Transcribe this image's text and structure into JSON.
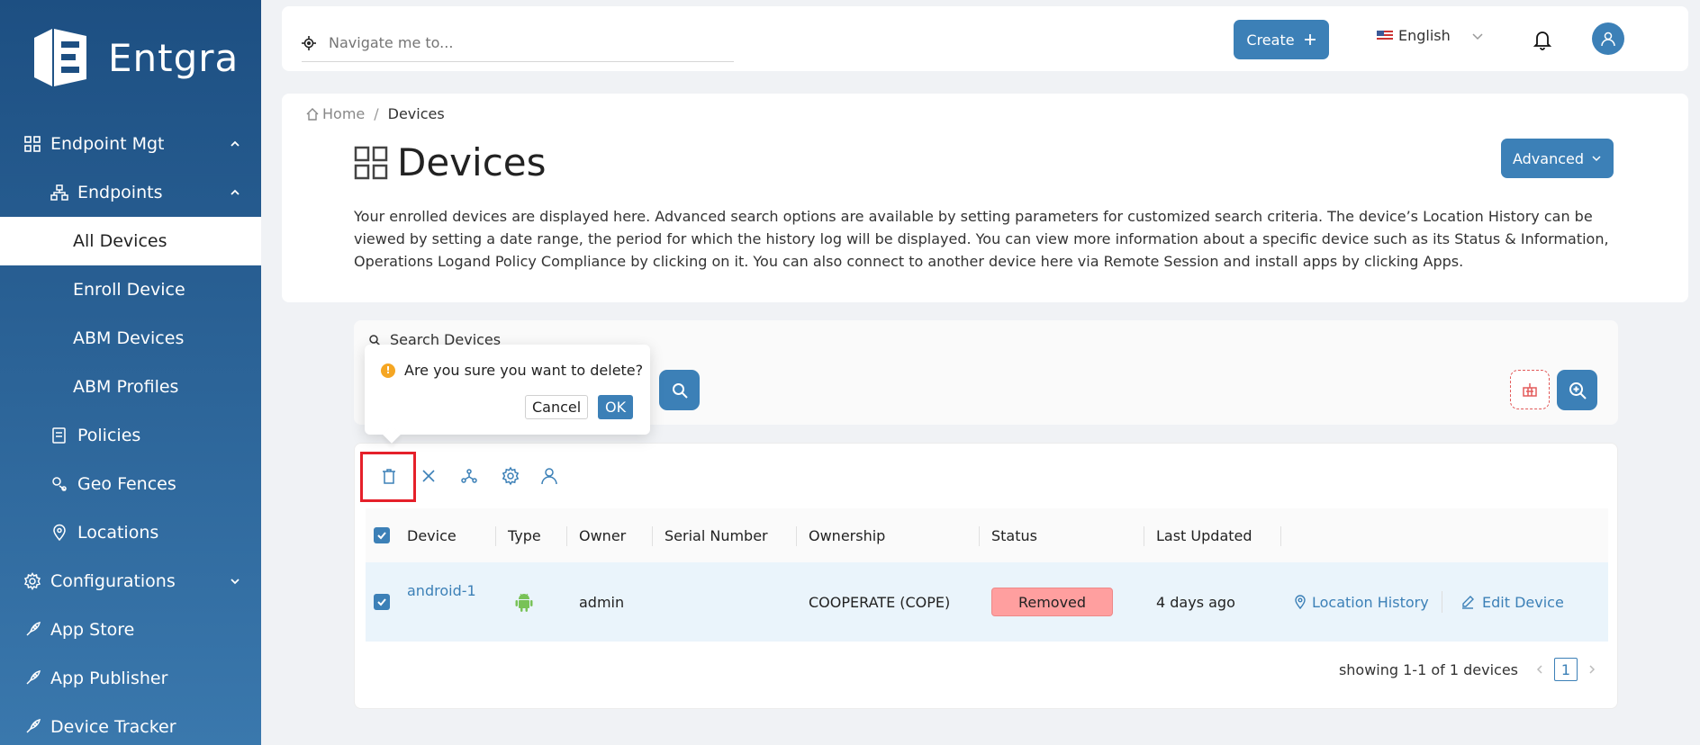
{
  "app": {
    "logo_text": "Entgra"
  },
  "sidebar": {
    "items": [
      {
        "label": "Endpoint Mgt"
      },
      {
        "label": "Endpoints"
      },
      {
        "label": "All Devices"
      },
      {
        "label": "Enroll Device"
      },
      {
        "label": "ABM Devices"
      },
      {
        "label": "ABM Profiles"
      },
      {
        "label": "Policies"
      },
      {
        "label": "Geo Fences"
      },
      {
        "label": "Locations"
      },
      {
        "label": "Configurations"
      },
      {
        "label": "App Store"
      },
      {
        "label": "App Publisher"
      },
      {
        "label": "Device Tracker"
      }
    ]
  },
  "topbar": {
    "search_placeholder": "Navigate me to...",
    "create_label": "Create",
    "language": "English"
  },
  "breadcrumb": {
    "home": "Home",
    "current": "Devices"
  },
  "page": {
    "title": "Devices",
    "advanced_label": "Advanced",
    "description": "Your enrolled devices are displayed here. Advanced search options are available by setting parameters for customized search criteria. The device’s Location History can be viewed by setting a date range, the period for which the history log will be displayed. You can view more information about a specific device such as its Status & Information, Operations Logand Policy Compliance by clicking on it. You can also connect to another device here via Remote Session and install apps by clicking Apps."
  },
  "search": {
    "label": "Search Devices"
  },
  "popconfirm": {
    "message": "Are you sure you want to delete?",
    "cancel_label": "Cancel",
    "ok_label": "OK"
  },
  "table": {
    "columns": [
      "Device",
      "Type",
      "Owner",
      "Serial Number",
      "Ownership",
      "Status",
      "Last Updated"
    ],
    "rows": [
      {
        "device": "android-1",
        "type_icon": "android-icon",
        "owner": "admin",
        "serial": "",
        "ownership": "COOPERATE (COPE)",
        "status": "Removed",
        "last_updated": "4 days ago",
        "action_location": "Location History",
        "action_edit": "Edit Device"
      }
    ]
  },
  "pagination": {
    "summary": "showing 1-1 of 1 devices",
    "current_page": "1"
  },
  "colors": {
    "primary": "#3c80b7",
    "sidebar_top": "#1d4f82",
    "sidebar_bottom": "#3a78ad",
    "danger": "#e5202a",
    "removed": "#ff9f9f",
    "android": "#78c257"
  }
}
